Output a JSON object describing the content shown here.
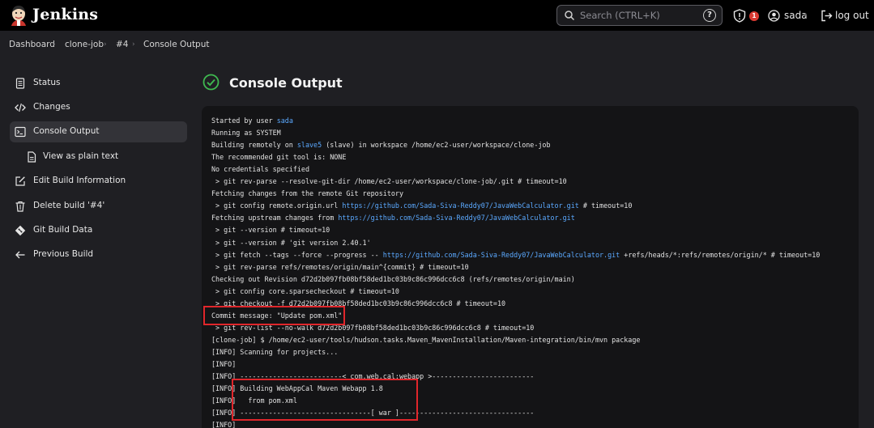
{
  "header": {
    "brand": "Jenkins",
    "search_placeholder": "Search (CTRL+K)",
    "help_glyph": "?",
    "notification_count": "1",
    "user": "sada",
    "logout": "log out"
  },
  "breadcrumb": [
    "Dashboard",
    "clone-job",
    "#4",
    "Console Output"
  ],
  "sidebar": [
    {
      "label": "Status",
      "icon": "document-icon"
    },
    {
      "label": "Changes",
      "icon": "code-icon"
    },
    {
      "label": "Console Output",
      "icon": "terminal-icon",
      "active": true
    },
    {
      "label": "View as plain text",
      "icon": "file-icon",
      "sub": true
    },
    {
      "label": "Edit Build Information",
      "icon": "edit-icon"
    },
    {
      "label": "Delete build '#4'",
      "icon": "trash-icon"
    },
    {
      "label": "Git Build Data",
      "icon": "git-icon"
    },
    {
      "label": "Previous Build",
      "icon": "arrow-left-icon"
    }
  ],
  "page": {
    "title": "Console Output",
    "status_icon": "success-check-icon",
    "accent": "#3fb950",
    "link_color": "#5ba9ff",
    "highlight_color": "#e0262b"
  },
  "console_lines": [
    {
      "parts": [
        {
          "t": "Started by user "
        },
        {
          "t": "sada",
          "link": true
        }
      ]
    },
    {
      "parts": [
        {
          "t": "Running as SYSTEM"
        }
      ]
    },
    {
      "parts": [
        {
          "t": "Building remotely on "
        },
        {
          "t": "slave5",
          "link": true
        },
        {
          "t": " (slave) in workspace /home/ec2-user/workspace/clone-job"
        }
      ]
    },
    {
      "parts": [
        {
          "t": "The recommended git tool is: NONE"
        }
      ]
    },
    {
      "parts": [
        {
          "t": "No credentials specified"
        }
      ]
    },
    {
      "parts": [
        {
          "t": " > git rev-parse --resolve-git-dir /home/ec2-user/workspace/clone-job/.git # timeout=10"
        }
      ]
    },
    {
      "parts": [
        {
          "t": "Fetching changes from the remote Git repository"
        }
      ]
    },
    {
      "parts": [
        {
          "t": " > git config remote.origin.url "
        },
        {
          "t": "https://github.com/Sada-Siva-Reddy07/JavaWebCalculator.git",
          "link": true
        },
        {
          "t": " # timeout=10"
        }
      ]
    },
    {
      "parts": [
        {
          "t": "Fetching upstream changes from "
        },
        {
          "t": "https://github.com/Sada-Siva-Reddy07/JavaWebCalculator.git",
          "link": true
        }
      ]
    },
    {
      "parts": [
        {
          "t": " > git --version # timeout=10"
        }
      ]
    },
    {
      "parts": [
        {
          "t": " > git --version # 'git version 2.40.1'"
        }
      ]
    },
    {
      "parts": [
        {
          "t": " > git fetch --tags --force --progress -- "
        },
        {
          "t": "https://github.com/Sada-Siva-Reddy07/JavaWebCalculator.git",
          "link": true
        },
        {
          "t": " +refs/heads/*:refs/remotes/origin/* # timeout=10"
        }
      ]
    },
    {
      "parts": [
        {
          "t": " > git rev-parse refs/remotes/origin/main^{commit} # timeout=10"
        }
      ]
    },
    {
      "parts": [
        {
          "t": "Checking out Revision d72d2b097fb08bf58ded1bc03b9c86c996dcc6c8 (refs/remotes/origin/main)"
        }
      ]
    },
    {
      "parts": [
        {
          "t": " > git config core.sparsecheckout # timeout=10"
        }
      ]
    },
    {
      "parts": [
        {
          "t": " > git checkout -f d72d2b097fb08bf58ded1bc03b9c86c996dcc6c8 # timeout=10"
        }
      ]
    },
    {
      "parts": [
        {
          "t": "Commit message: \"Update pom.xml\""
        }
      ]
    },
    {
      "parts": [
        {
          "t": " > git rev-list --no-walk d72d2b097fb08bf58ded1bc03b9c86c996dcc6c8 # timeout=10"
        }
      ]
    },
    {
      "parts": [
        {
          "t": "[clone-job] $ /home/ec2-user/tools/hudson.tasks.Maven_MavenInstallation/Maven-integration/bin/mvn package"
        }
      ]
    },
    {
      "parts": [
        {
          "t": "[INFO] Scanning for projects..."
        }
      ]
    },
    {
      "parts": [
        {
          "t": "[INFO]"
        }
      ]
    },
    {
      "parts": [
        {
          "t": "[INFO] -------------------------< com.web.cal:webapp >-------------------------"
        }
      ]
    },
    {
      "parts": [
        {
          "t": "[INFO] Building WebAppCal Maven Webapp 1.8"
        }
      ]
    },
    {
      "parts": [
        {
          "t": "[INFO]   from pom.xml"
        }
      ]
    },
    {
      "parts": [
        {
          "t": "[INFO] --------------------------------[ war ]---------------------------------"
        }
      ]
    },
    {
      "parts": [
        {
          "t": "[INFO]"
        }
      ]
    }
  ]
}
